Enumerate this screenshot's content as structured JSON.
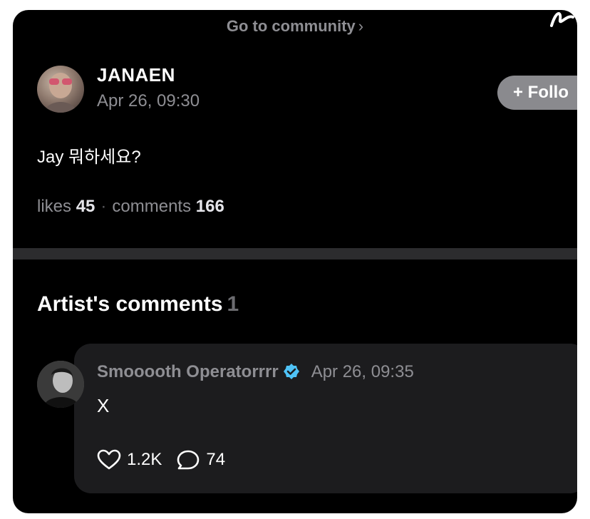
{
  "header": {
    "community_link": "Go to community",
    "community_chevron": "›"
  },
  "post": {
    "author": "JANAEN",
    "timestamp": "Apr 26, 09:30",
    "follow_label": "+ Follo",
    "text": "Jay 뭐하세요?",
    "likes_label": "likes",
    "likes_count": "45",
    "separator": "·",
    "comments_label": "comments",
    "comments_count": "166"
  },
  "artist_comments": {
    "title": "Artist's comments",
    "count": "1",
    "items": [
      {
        "author": "Smooooth Operatorrrr",
        "timestamp": "Apr 26, 09:35",
        "text": "X",
        "likes": "1.2K",
        "replies": "74"
      }
    ]
  },
  "colors": {
    "background": "#000000",
    "card": "#1c1c1e",
    "muted": "#8e8e93",
    "verified": "#4fc3f7"
  },
  "icons": [
    "handwriting-glyph-icon",
    "verified-badge-icon",
    "heart-icon",
    "comment-bubble-icon"
  ]
}
